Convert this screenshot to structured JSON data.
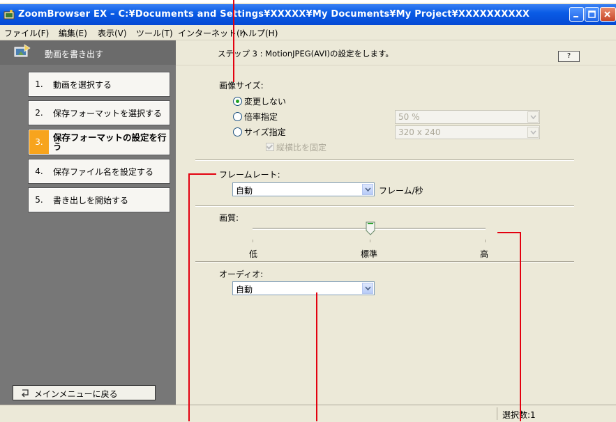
{
  "window": {
    "title": "ZoomBrowser EX  –  C:¥Documents and Settings¥XXXXX¥My Documents¥My Project¥XXXXXXXXXX",
    "buttons": [
      "minimize",
      "maximize",
      "close"
    ]
  },
  "menu": [
    "ファイル(F)",
    "編集(E)",
    "表示(V)",
    "ツール(T)",
    "インターネット(I)",
    "ヘルプ(H)"
  ],
  "left_panel": {
    "title": "動画を書き出す",
    "steps": [
      {
        "num": "1.",
        "label": "動画を選択する"
      },
      {
        "num": "2.",
        "label": "保存フォーマットを選択する"
      },
      {
        "num": "3.",
        "label": "保存フォーマットの設定を行う",
        "active": true
      },
      {
        "num": "4.",
        "label": "保存ファイル名を設定する"
      },
      {
        "num": "5.",
        "label": "書き出しを開始する"
      }
    ],
    "back_button": "メインメニューに戻る"
  },
  "main": {
    "step_description": "ステップ 3 : MotionJPEG(AVI)の設定をします。",
    "help_label": "?",
    "image_size": {
      "label": "画像サイズ:",
      "options": [
        "変更しない",
        "倍率指定",
        "サイズ指定"
      ],
      "selected": "変更しない",
      "scale_value": "50 %",
      "size_value": "320 x 240",
      "keep_aspect_label": "縦横比を固定"
    },
    "frame_rate": {
      "label": "フレームレート:",
      "value": "自動",
      "unit": "フレーム/秒"
    },
    "quality": {
      "label": "画質:",
      "ticks": [
        "低",
        "標準",
        "高"
      ],
      "level": "標準"
    },
    "audio": {
      "label": "オーディオ:",
      "value": "自動"
    }
  },
  "status_bar": {
    "selection_count": "選択数:1"
  },
  "colors": {
    "titlebar": "#0a5ce6",
    "left_panel": "#777777",
    "active_step": "#f7a41d",
    "annotation": "#e3000f"
  }
}
